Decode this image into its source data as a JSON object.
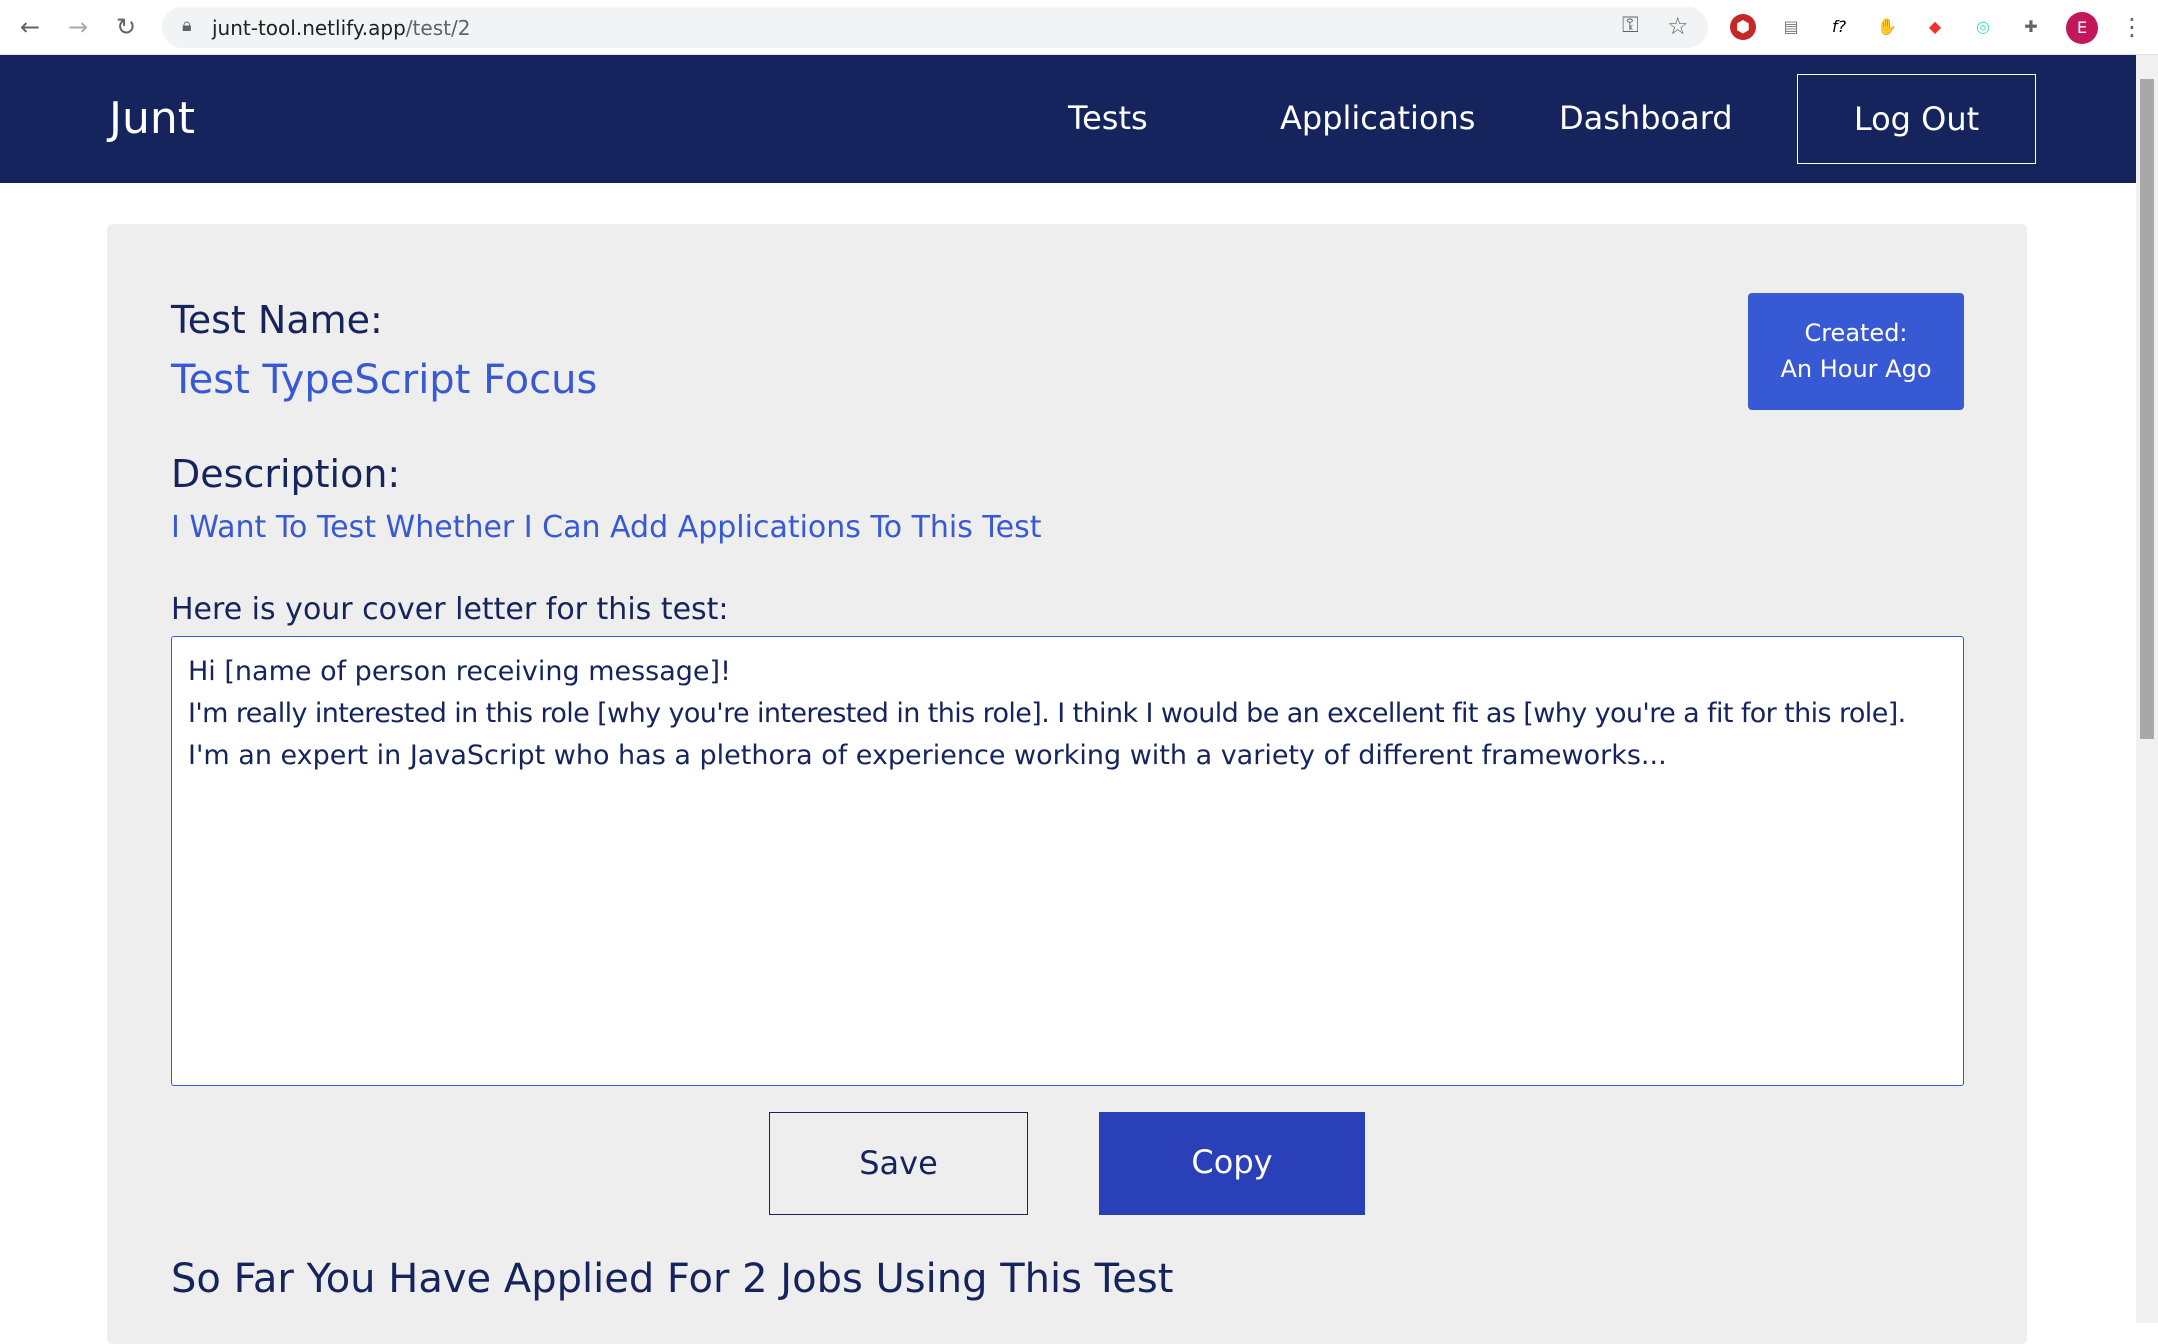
{
  "browser": {
    "url_host": "junt-tool.netlify.app",
    "url_path": "/test/2",
    "profile_initial": "E"
  },
  "nav": {
    "brand": "Junt",
    "links": [
      "Tests",
      "Applications",
      "Dashboard"
    ],
    "logout": "Log Out"
  },
  "test": {
    "name_label": "Test Name:",
    "name": "Test TypeScript Focus",
    "created_label": "Created:",
    "created_value": "An Hour Ago",
    "description_label": "Description:",
    "description": "I Want To Test Whether I Can Add Applications To This Test",
    "cover_label": "Here is your cover letter for this test:",
    "cover_lines": [
      "Hi [name of person receiving message]!",
      "I'm really interested in this role [why you're interested in this role]. I think I would be an excellent fit as [why you're a fit for this role].",
      "I'm an expert in JavaScript who has a plethora of experience working with a variety of different frameworks..."
    ]
  },
  "actions": {
    "save": "Save",
    "copy": "Copy"
  },
  "applied_heading": "So Far You Have Applied For 2 Jobs Using This Test"
}
